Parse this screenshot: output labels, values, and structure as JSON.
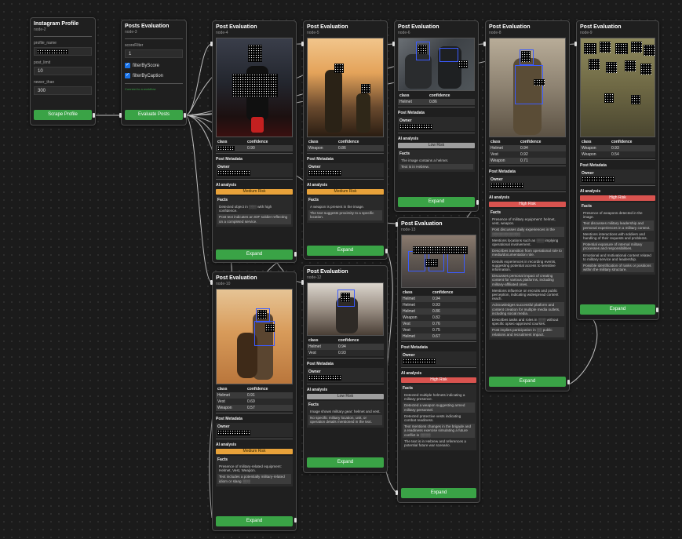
{
  "instagram_node": {
    "title": "Instagram Profile",
    "id": "node-2",
    "fields": [
      {
        "label": "profile_name",
        "value": ""
      },
      {
        "label": "post_limit",
        "value": "10"
      },
      {
        "label": "newer_than",
        "value": "300"
      }
    ],
    "button": "Scrape Profile"
  },
  "filter_node": {
    "title": "Posts Evaluation",
    "id": "node-3",
    "score_label": "scoreFilter",
    "score_value": "1",
    "check1": "filterByScore",
    "check2": "filterByCaption",
    "note": "Connect to a workflow",
    "button": "Evaluate Posts"
  },
  "post_title": "Post Evaluation",
  "headers": {
    "class": "class",
    "confidence": "confidence",
    "metadata": "Post Metadata",
    "owner": "Owner",
    "ai": "AI analysis",
    "facts": "Facts",
    "expand": "Expand"
  },
  "posts": [
    {
      "id": "node-4",
      "rows": [
        [
          "",
          "0.90"
        ]
      ],
      "risk": "Medium Risk",
      "facts": [
        "Detected object in ░░░ with high confidence.",
        "Post text indicates an IDF soldier reflecting on a completed service."
      ]
    },
    {
      "id": "node-5",
      "rows": [
        [
          "Weapon",
          "0.86"
        ]
      ],
      "risk": "Medium Risk",
      "facts": [
        "A weapon is present in the image.",
        "The text suggests proximity to a specific location."
      ]
    },
    {
      "id": "node-6",
      "rows": [
        [
          "Helmet",
          "0.86"
        ]
      ],
      "risk": "Low Risk",
      "facts": [
        "The image contains a helmet.",
        "Text is in Hebrew."
      ]
    },
    {
      "id": "node-8",
      "rows": [
        [
          "Helmet",
          "0.94"
        ],
        [
          "Vest",
          "0.92"
        ],
        [
          "Weapon",
          "0.71"
        ]
      ],
      "risk": "High Risk",
      "facts": [
        "Presence of military equipment: helmet, vest, weapon.",
        "Post discusses daily experiences in the ░░░░░░░░░░░",
        "Mentions locations such as ░░░ implying operational involvement.",
        "Describes transition from operational role to media/documentation role.",
        "Details experiences in recording events, suggesting potential access to sensitive information.",
        "Discusses personal impact of creating content for various platforms, including military-affiliated ones.",
        "Mentions influence on recruits and public perception, indicating widespread content reach.",
        "Acknowledges successful platform and content creation for multiple media outlets, including social media.",
        "Describes tasks and roles in ░░░ without specific opsec-approved courses.",
        "Post implies participation in ░░ public relations and recruitment impact."
      ]
    },
    {
      "id": "node-9",
      "rows": [
        [
          "Weapon",
          "0.93"
        ],
        [
          "Weapon",
          "0.54"
        ]
      ],
      "risk": "High Risk",
      "facts": [
        "Presence of weapons detected in the image.",
        "Text discusses military leadership and personal experiences in a military context.",
        "Mentions interactions with soldiers and handling of their requests and problems.",
        "Potential exposure of internal military processes and responsibilities.",
        "Emotional and motivational content related to military service and leadership.",
        "Possible identification of ranks or positions within the military structure."
      ]
    },
    {
      "id": "node-10",
      "rows": [
        [
          "Helmet",
          "0.91"
        ],
        [
          "Vest",
          "0.69"
        ],
        [
          "Weapon",
          "0.57"
        ]
      ],
      "risk": "Medium Risk",
      "facts": [
        "Presence of military-related equipment: Helmet, Vest, Weapon.",
        "Text includes a potentially military-related idiom or slang ░░░"
      ]
    },
    {
      "id": "node-12",
      "rows": [
        [
          "Helmet",
          "0.94"
        ],
        [
          "Vest",
          "0.93"
        ]
      ],
      "risk": "Low Risk",
      "facts": [
        "Image shows military gear: helmet and vest.",
        "No specific military location, unit, or operation details mentioned in the text."
      ]
    },
    {
      "id": "node-13",
      "rows": [
        [
          "Helmet",
          "0.94"
        ],
        [
          "Helmet",
          "0.93"
        ],
        [
          "Helmet",
          "0.86"
        ],
        [
          "Weapon",
          "0.82"
        ],
        [
          "Vest",
          "0.76"
        ],
        [
          "Vest",
          "0.75"
        ],
        [
          "Helmet",
          "0.67"
        ]
      ],
      "risk": "High Risk",
      "facts": [
        "Detected multiple helmets indicating a military presence.",
        "Detected a weapon suggesting armed military personnel.",
        "Detected protective vests indicating combat readiness.",
        "Text mentions changes in the brigade and a readiness exercise simulating a future conflict in ░░░░",
        "The text is in Hebrew and references a potential future war scenario."
      ]
    }
  ],
  "colors": {
    "green": "#3aa346",
    "medium": "#e8a23a",
    "high": "#d9534f",
    "low": "#9e9e9e"
  }
}
